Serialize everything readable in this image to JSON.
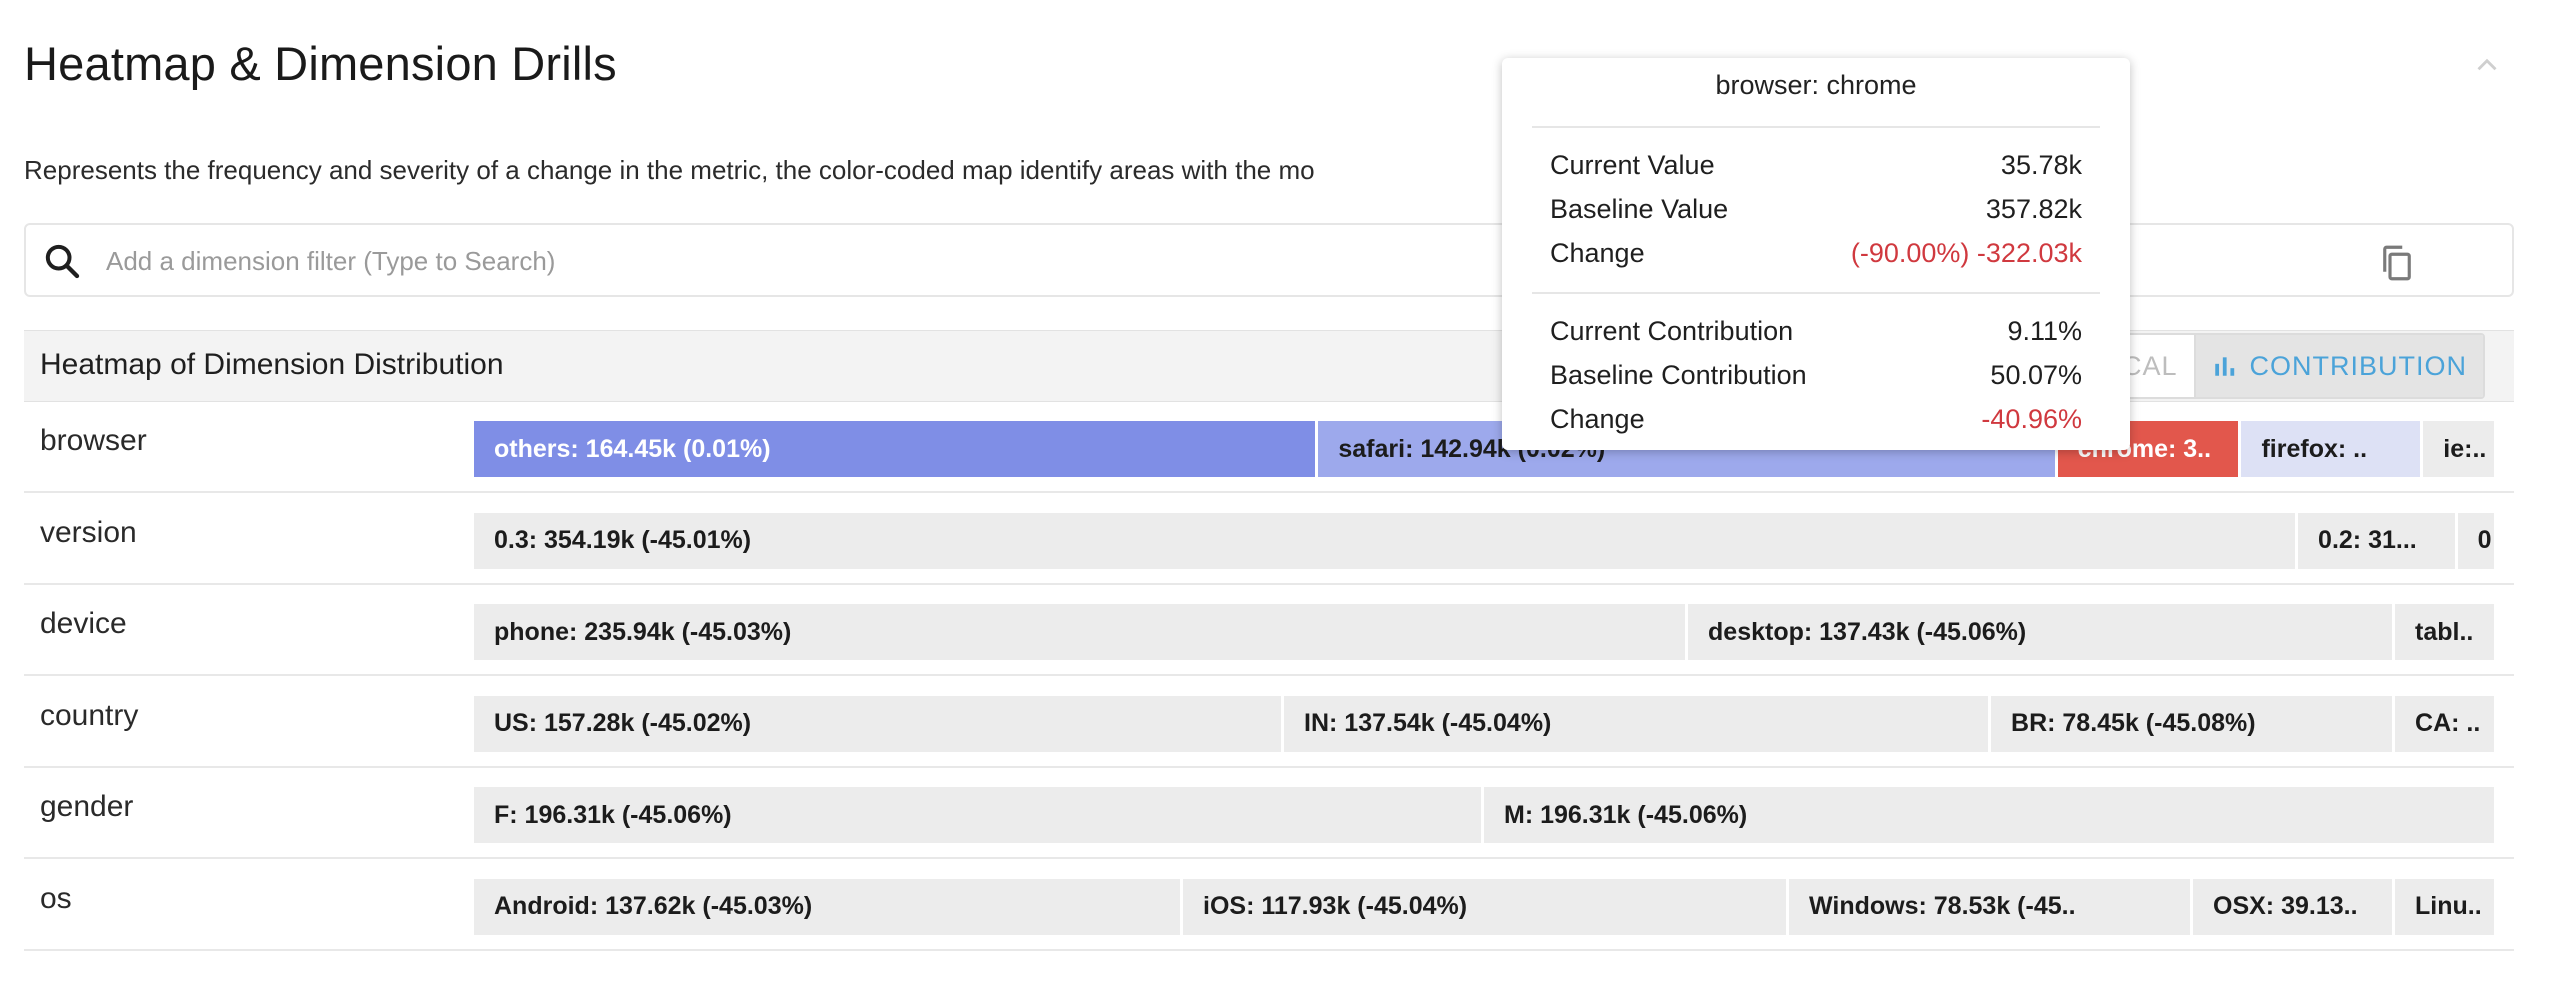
{
  "section": {
    "title": "Heatmap & Dimension Drills",
    "description": "Represents the frequency and severity of a change in the metric, the color-coded map identify areas with the mo"
  },
  "filter": {
    "placeholder": "Add a dimension filter (Type to Search)",
    "value": ""
  },
  "heatmap": {
    "title": "Heatmap of Dimension Distribution",
    "toggle_options": [
      "CAL",
      "CONTRIBUTION"
    ],
    "selected_toggle": "CONTRIBUTION",
    "colors": {
      "neutral": "#ececec",
      "blue_strong": "#7f8ee6",
      "blue_mid": "#9da9ec",
      "blue_light": "#dde1f5",
      "red": "#e2574c",
      "accent": "#4ba3d9"
    },
    "rows": [
      {
        "label": "browser",
        "cells": [
          {
            "text": "others: 164.45k (0.01%)",
            "share": 0.418,
            "color": "#7f8ee6",
            "text_color": "#ffffff"
          },
          {
            "text": "safari: 142.94k (0.02%)",
            "share": 0.366,
            "color": "#9da9ec",
            "text_color": "#1c1c1c"
          },
          {
            "text": "chrome: 3..",
            "share": 0.091,
            "color": "#e2574c",
            "text_color": "#ffffff"
          },
          {
            "text": "firefox: ..",
            "share": 0.09,
            "color": "#dde1f5",
            "text_color": "#1c1c1c"
          },
          {
            "text": "ie:..",
            "share": 0.035,
            "color": "#ececec",
            "text_color": "#1c1c1c"
          }
        ]
      },
      {
        "label": "version",
        "cells": [
          {
            "text": "0.3: 354.19k (-45.01%)",
            "share": 0.903,
            "color": "#ececec",
            "text_color": "#1c1c1c"
          },
          {
            "text": "0.2: 31...",
            "share": 0.079,
            "color": "#ececec",
            "text_color": "#1c1c1c"
          },
          {
            "text": "0",
            "share": 0.018,
            "color": "#ececec",
            "text_color": "#1c1c1c"
          }
        ]
      },
      {
        "label": "device",
        "cells": [
          {
            "text": "phone: 235.94k (-45.03%)",
            "share": 0.601,
            "color": "#ececec",
            "text_color": "#1c1c1c"
          },
          {
            "text": "desktop: 137.43k (-45.06%)",
            "share": 0.35,
            "color": "#ececec",
            "text_color": "#1c1c1c"
          },
          {
            "text": "tabl..",
            "share": 0.049,
            "color": "#ececec",
            "text_color": "#1c1c1c"
          }
        ]
      },
      {
        "label": "country",
        "cells": [
          {
            "text": "US: 157.28k (-45.02%)",
            "share": 0.401,
            "color": "#ececec",
            "text_color": "#1c1c1c"
          },
          {
            "text": "IN: 137.54k (-45.04%)",
            "share": 0.35,
            "color": "#ececec",
            "text_color": "#1c1c1c"
          },
          {
            "text": "BR: 78.45k (-45.08%)",
            "share": 0.2,
            "color": "#ececec",
            "text_color": "#1c1c1c"
          },
          {
            "text": "CA: ..",
            "share": 0.049,
            "color": "#ececec",
            "text_color": "#1c1c1c"
          }
        ]
      },
      {
        "label": "gender",
        "cells": [
          {
            "text": "F: 196.31k (-45.06%)",
            "share": 0.5,
            "color": "#ececec",
            "text_color": "#1c1c1c"
          },
          {
            "text": "M: 196.31k (-45.06%)",
            "share": 0.5,
            "color": "#ececec",
            "text_color": "#1c1c1c"
          }
        ]
      },
      {
        "label": "os",
        "cells": [
          {
            "text": "Android: 137.62k (-45.03%)",
            "share": 0.351,
            "color": "#ececec",
            "text_color": "#1c1c1c"
          },
          {
            "text": "iOS: 117.93k (-45.04%)",
            "share": 0.3,
            "color": "#ececec",
            "text_color": "#1c1c1c"
          },
          {
            "text": "Windows: 78.53k (-45..",
            "share": 0.2,
            "color": "#ececec",
            "text_color": "#1c1c1c"
          },
          {
            "text": "OSX: 39.13..",
            "share": 0.1,
            "color": "#ececec",
            "text_color": "#1c1c1c"
          },
          {
            "text": "Linu..",
            "share": 0.049,
            "color": "#ececec",
            "text_color": "#1c1c1c"
          }
        ]
      }
    ]
  },
  "tooltip": {
    "title": "browser: chrome",
    "rows_a": [
      {
        "label": "Current Value",
        "value": "35.78k",
        "negative": false
      },
      {
        "label": "Baseline Value",
        "value": "357.82k",
        "negative": false
      },
      {
        "label": "Change",
        "value": "(-90.00%) -322.03k",
        "negative": true
      }
    ],
    "rows_b": [
      {
        "label": "Current Contribution",
        "value": "9.11%",
        "negative": false
      },
      {
        "label": "Baseline Contribution",
        "value": "50.07%",
        "negative": false
      },
      {
        "label": "Change",
        "value": "-40.96%",
        "negative": true
      }
    ]
  },
  "icons": {
    "collapse": "chevron-up-icon",
    "search": "search-icon",
    "copy": "copy-icon",
    "chart": "bar-chart-icon"
  }
}
